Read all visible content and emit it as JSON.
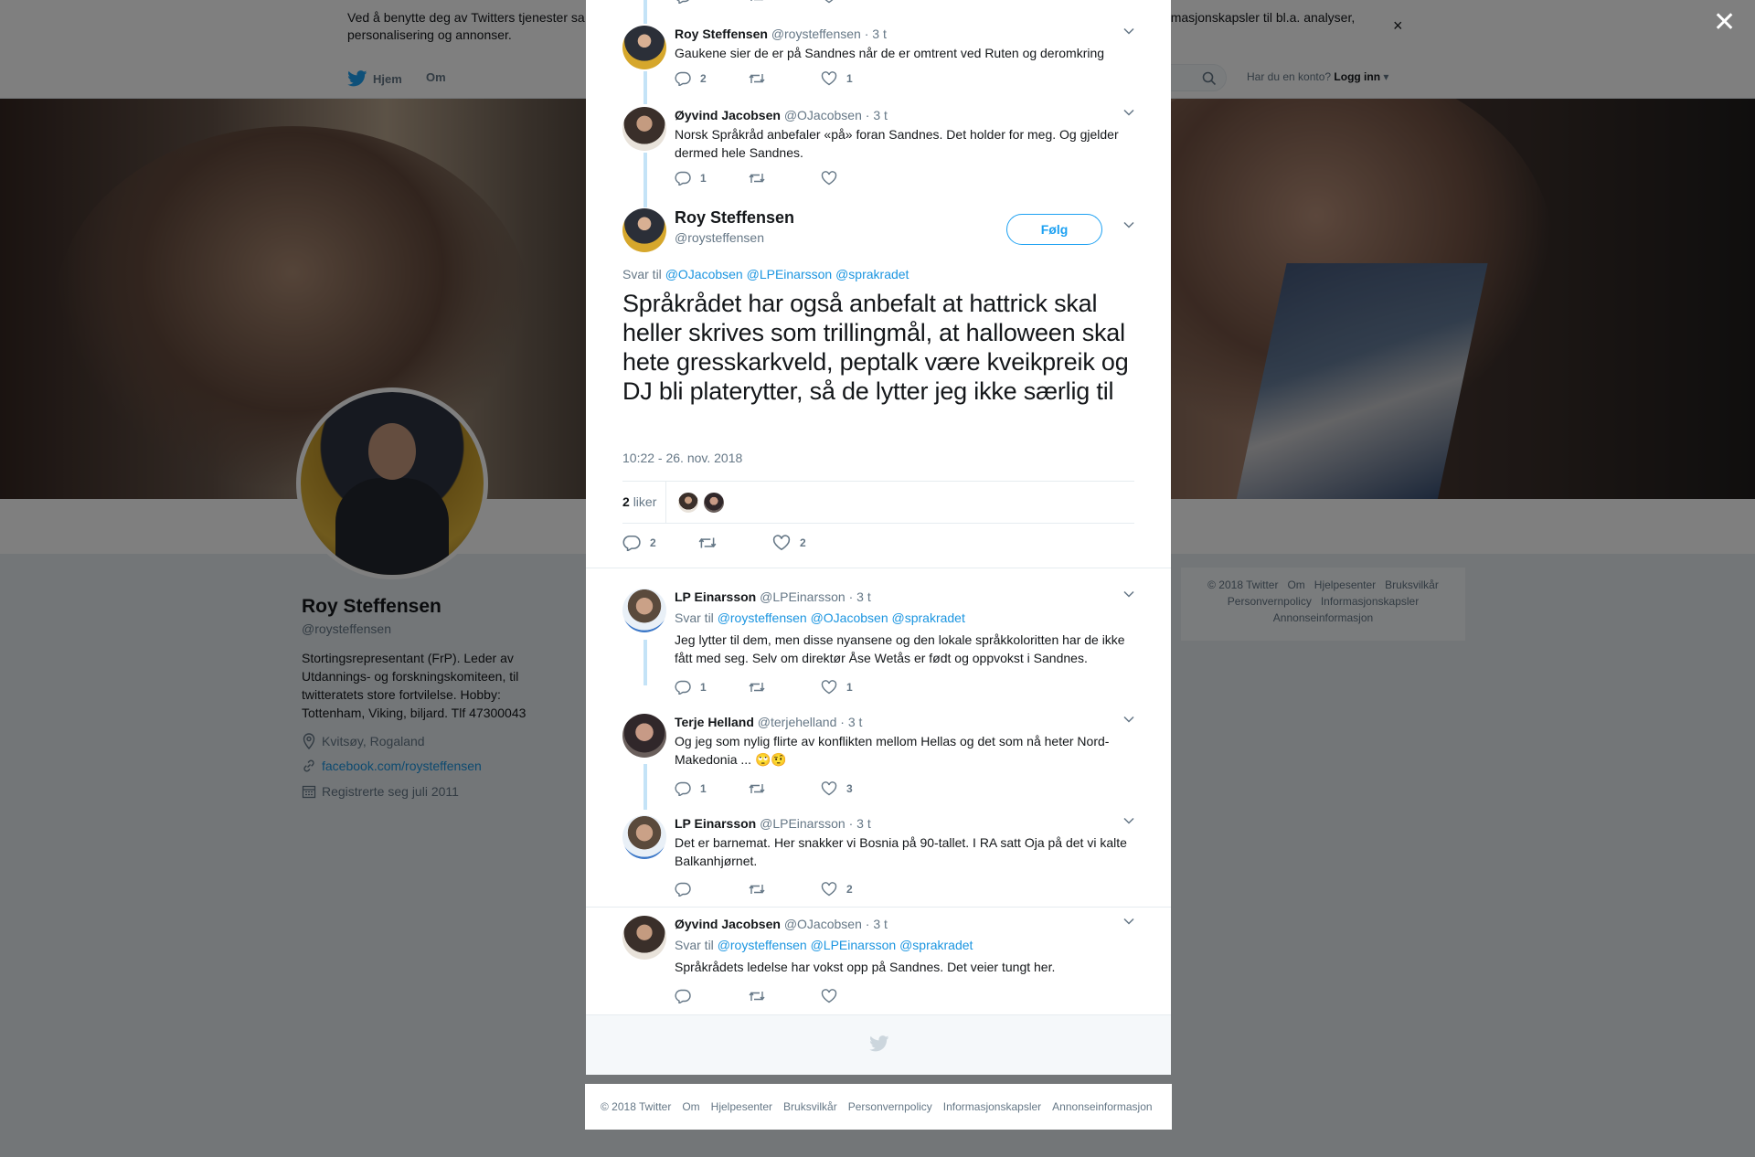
{
  "cookie_bar": {
    "text": "Ved å benytte deg av Twitters tjenester sa                                                                                             informasjonskapsler til bl.a. analyser, personalisering og annonser.",
    "text_left": "Ved å benytte deg av Twitters tjenester sa",
    "text_right": "informasjonskapsler til bl.a. analyser,",
    "text_line2": "personalisering og annonser.",
    "close": "×"
  },
  "nav": {
    "home": "Hjem",
    "about": "Om",
    "login_prompt": "Har du en konto?",
    "login": "Logg inn"
  },
  "profile": {
    "name": "Roy Steffensen",
    "handle": "@roysteffensen",
    "bio": "Stortingsrepresentant (FrP). Leder av Utdannings- og forskningskomiteen, til twitteratets store fortvilelse. Hobby: Tottenham, Viking, biljard. Tlf 47300043",
    "location": "Kvitsøy, Rogaland",
    "website": "facebook.com/roysteffensen",
    "joined": "Registrerte seg juli 2011"
  },
  "side_footer": {
    "items": [
      "© 2018 Twitter",
      "Om",
      "Hjelpesenter",
      "Bruksvilkår",
      "Personvernpolicy",
      "Informasjonskapsler",
      "Annonseinformasjon"
    ]
  },
  "overlay_close": "✕",
  "thread": [
    {
      "name": "Roy Steffensen",
      "handle": "@roysteffensen",
      "time": "· 3 t",
      "text": "Gaukene sier de er på Sandnes når de er omtrent ved Ruten og deromkring",
      "replies": "2",
      "retweets": "",
      "likes": "1"
    },
    {
      "name": "Øyvind Jacobsen",
      "handle": "@OJacobsen",
      "time": "· 3 t",
      "text": "Norsk Språkråd anbefaler «på» foran Sandnes. Det holder for meg. Og gjelder dermed hele Sandnes.",
      "replies": "1",
      "retweets": "",
      "likes": ""
    }
  ],
  "main_tweet": {
    "name": "Roy Steffensen",
    "handle": "@roysteffensen",
    "follow": "Følg",
    "reply_label": "Svar til",
    "reply_to": "@OJacobsen @LPEinarsson @sprakradet",
    "text": "Språkrådet har også anbefalt at hattrick skal heller skrives som trillingmål, at halloween skal hete gresskarkveld, peptalk være kveikpreik og DJ bli platerytter, så de lytter jeg ikke særlig til",
    "timestamp": "10:22 - 26. nov. 2018",
    "likes_count": "2",
    "likes_label": "liker",
    "replies": "2",
    "retweets": "",
    "likes": "2"
  },
  "replies": [
    {
      "name": "LP Einarsson",
      "handle": "@LPEinarsson",
      "time": "· 3 t",
      "reply_label": "Svar til",
      "reply_to": "@roysteffensen @OJacobsen @sprakradet",
      "text": "Jeg lytter til dem, men disse nyansene og den lokale språkkoloritten har de ikke fått med seg. Selv om direktør Åse Wetås er født og oppvokst i Sandnes.",
      "replies": "1",
      "retweets": "",
      "likes": "1"
    },
    {
      "name": "Terje Helland",
      "handle": "@terjehelland",
      "time": "· 3 t",
      "text": "Og jeg som nylig flirte av konflikten mellom Hellas og det som nå heter Nord-Makedonia ... 🙄🤨",
      "replies": "1",
      "retweets": "",
      "likes": "3"
    },
    {
      "name": "LP Einarsson",
      "handle": "@LPEinarsson",
      "time": "· 3 t",
      "text": "Det er barnemat. Her snakker vi Bosnia på 90-tallet. I RA satt Oja på det vi kalte Balkanhjørnet.",
      "replies": "",
      "retweets": "",
      "likes": "2"
    },
    {
      "name": "Øyvind Jacobsen",
      "handle": "@OJacobsen",
      "time": "· 3 t",
      "reply_label": "Svar til",
      "reply_to": "@roysteffensen @LPEinarsson @sprakradet",
      "text": "Språkrådets ledelse har vokst opp på Sandnes. Det veier tungt her.",
      "replies": "",
      "retweets": "",
      "likes": ""
    }
  ],
  "bottom_footer": {
    "items": [
      "© 2018 Twitter",
      "Om",
      "Hjelpesenter",
      "Bruksvilkår",
      "Personvernpolicy",
      "Informasjonskapsler",
      "Annonseinformasjon"
    ]
  },
  "colors": {
    "accent": "#1da1f2",
    "link": "#1b95e0",
    "muted": "#657786",
    "thread_line": "#c4e3f7"
  }
}
